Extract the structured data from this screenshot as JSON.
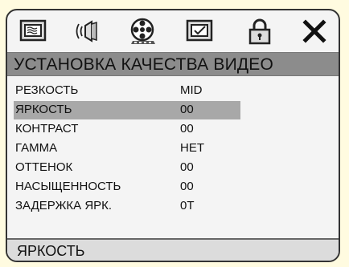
{
  "tabs": [
    {
      "name": "general-setup-tab",
      "icon": "tv-screen-icon"
    },
    {
      "name": "audio-setup-tab",
      "icon": "speaker-icon"
    },
    {
      "name": "video-setup-tab",
      "icon": "film-reel-icon",
      "active": true
    },
    {
      "name": "preference-tab",
      "icon": "checkbox-icon"
    },
    {
      "name": "password-tab",
      "icon": "lock-icon"
    },
    {
      "name": "exit-tab",
      "icon": "close-icon"
    }
  ],
  "title": "УСТАНОВКА КАЧЕСТВА ВИДЕО",
  "rows": [
    {
      "label": "РЕЗКОСТЬ",
      "value": "MID"
    },
    {
      "label": "ЯРКОСТЬ",
      "value": "00",
      "selected": true
    },
    {
      "label": "КОНТРАСТ",
      "value": "00"
    },
    {
      "label": "ГАММА",
      "value": "НЕТ"
    },
    {
      "label": "ОТТЕНОК",
      "value": "00"
    },
    {
      "label": "НАСЫЩЕННОСТЬ",
      "value": "00"
    },
    {
      "label": "ЗАДЕРЖКА ЯРК.",
      "value": "0T"
    }
  ],
  "status": "ЯРКОСТЬ",
  "colors": {
    "background": "#fffbe0",
    "title_bar": "#8c8c8c",
    "selection": "#a8a8a8"
  }
}
